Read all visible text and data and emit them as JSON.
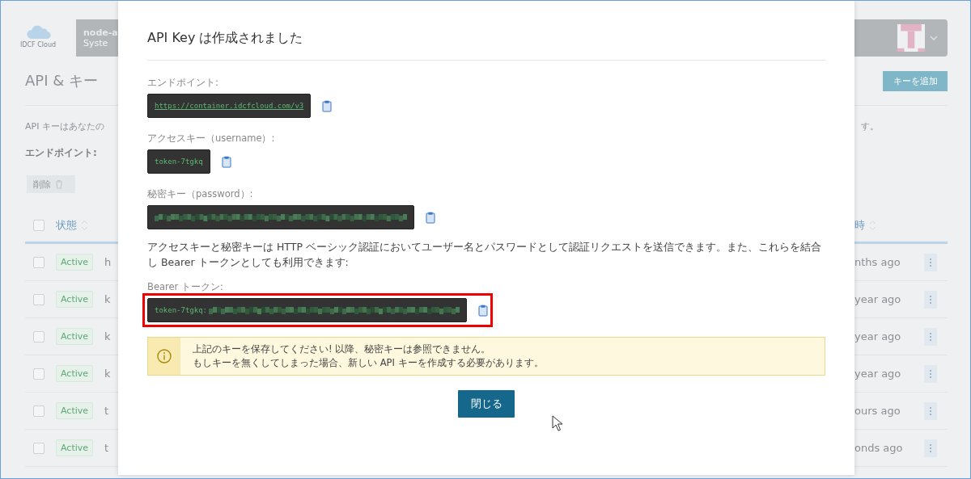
{
  "background_page": {
    "logo": {
      "text": "IDCF Cloud"
    },
    "project_bar": {
      "name": "node-a",
      "subtitle": "Syste"
    },
    "title": "API & キー",
    "add_key_button": "キーを追加",
    "description_start": "API キーはあなたの",
    "description_end": "す。",
    "endpoint_label": "エンドポイント:",
    "delete_button": "削除",
    "table": {
      "header_checked": false,
      "columns": [
        {
          "label": "状態"
        },
        {
          "label": "時"
        }
      ],
      "rows": [
        {
          "checked": false,
          "status": "Active",
          "column_2": "h",
          "column_3": "nths ago"
        },
        {
          "checked": false,
          "status": "Active",
          "column_2": "k",
          "column_3": "year ago"
        },
        {
          "checked": false,
          "status": "Active",
          "column_2": "k",
          "column_3": "year ago"
        },
        {
          "checked": false,
          "status": "Active",
          "column_2": "k",
          "column_3": "year ago"
        },
        {
          "checked": false,
          "status": "Active",
          "column_2": "t",
          "column_3": "ours ago"
        },
        {
          "checked": false,
          "status": "Active",
          "column_2": "t",
          "column_3": "onds ago"
        }
      ]
    }
  },
  "modal": {
    "title": "API Key は作成されました",
    "sections": [
      {
        "kind": "code",
        "label": "エンドポイント:",
        "value": "https://container.idcfcloud.com/v3",
        "link": true,
        "highlighted": false
      },
      {
        "kind": "code",
        "label": "アクセスキー（username）:",
        "value": "token-7tgkq",
        "link": false,
        "highlighted": false
      },
      {
        "kind": "masked",
        "label": "秘密キー（password）:",
        "highlighted": false
      },
      {
        "kind": "paragraph",
        "text": "アクセスキーと秘密キーは HTTP ベーシック認証においてユーザー名とパスワードとして認証リクエストを送信できます。また、これらを結合し Bearer トークンとしても利用できます:"
      },
      {
        "kind": "masked",
        "label": "Bearer トークン:",
        "value": "token-7tgkq:",
        "highlighted": true
      }
    ],
    "alert": {
      "lines": [
        "上記のキーを保存してください! 以降、秘密キーは参照できません。",
        "もしキーを無くしてしまった場合、新しい API キーを作成する必要があります。"
      ]
    },
    "close_button": "閉じる"
  }
}
